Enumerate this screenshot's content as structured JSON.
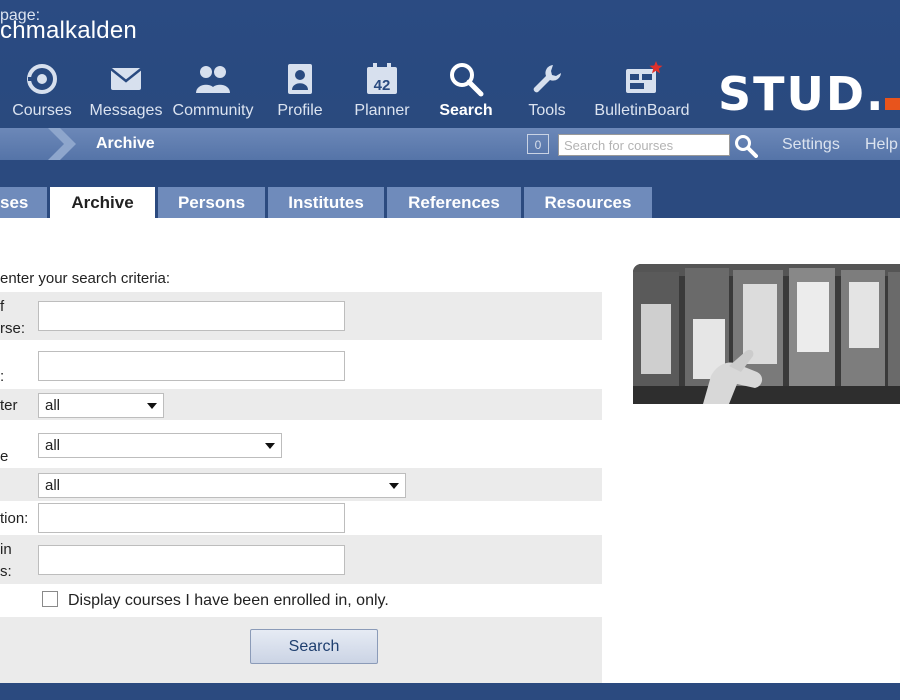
{
  "header": {
    "title": "chmalkalden",
    "nav": [
      {
        "label": "Courses",
        "icon": "courses-icon"
      },
      {
        "label": "Messages",
        "icon": "envelope-icon"
      },
      {
        "label": "Community",
        "icon": "people-icon"
      },
      {
        "label": "Profile",
        "icon": "profile-icon"
      },
      {
        "label": "Planner",
        "icon": "calendar-icon",
        "badge": "42"
      },
      {
        "label": "Search",
        "icon": "magnifier-icon",
        "active": true
      },
      {
        "label": "Tools",
        "icon": "wrench-icon"
      },
      {
        "label": "BulletinBoard",
        "icon": "bulletin-icon"
      }
    ],
    "logo_text": "STUD."
  },
  "breadcrumb": {
    "label": "page:",
    "current": "Archive"
  },
  "quicksearch": {
    "counter": "0",
    "placeholder": "Search for courses"
  },
  "links": {
    "settings": "Settings",
    "help": "Help"
  },
  "tabs": [
    {
      "label": "ses"
    },
    {
      "label": "Archive",
      "active": true
    },
    {
      "label": "Persons"
    },
    {
      "label": "Institutes"
    },
    {
      "label": "References"
    },
    {
      "label": "Resources"
    }
  ],
  "form": {
    "instruction": "enter your search criteria:",
    "fields": [
      {
        "label_lines": [
          "f",
          "rse:"
        ],
        "type": "text"
      },
      {
        "label_lines": [
          ":"
        ],
        "type": "text"
      },
      {
        "label_lines": [
          "ter"
        ],
        "type": "select",
        "value": "all"
      },
      {
        "label_lines": [
          "e"
        ],
        "type": "select",
        "value": "all"
      },
      {
        "label_lines": [
          ""
        ],
        "type": "select",
        "value": "all"
      },
      {
        "label_lines": [
          "tion:"
        ],
        "type": "text"
      },
      {
        "label_lines": [
          "in",
          "s:"
        ],
        "type": "text"
      }
    ],
    "checkbox_label": "Display courses I have been enrolled in, only.",
    "checkbox_checked": false,
    "submit_label": "Search"
  },
  "colors": {
    "header_bg": "#2b4a7f",
    "crumb_bg": "#6480b2",
    "tab_bg": "#6f8bbb",
    "logo_accent": "#e8541c"
  }
}
